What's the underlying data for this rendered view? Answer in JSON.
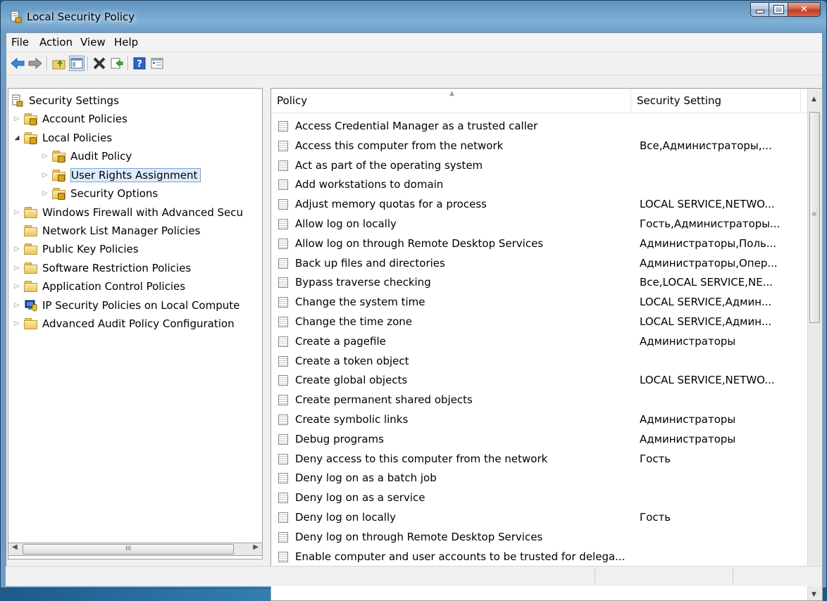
{
  "window": {
    "title": "Local Security Policy"
  },
  "menu": [
    "File",
    "Action",
    "View",
    "Help"
  ],
  "toolbar": [
    "back-icon",
    "forward-icon",
    "up-folder-icon",
    "show-hide-tree-icon",
    "delete-icon",
    "export-list-icon",
    "help-icon",
    "properties-icon"
  ],
  "tree": {
    "root": "Security Settings",
    "items": [
      "Account Policies",
      "Local Policies",
      "Audit Policy",
      "User Rights Assignment",
      "Security Options",
      "Windows Firewall with Advanced Secu",
      "Network List Manager Policies",
      "Public Key Policies",
      "Software Restriction Policies",
      "Application Control Policies",
      "IP Security Policies on Local Compute",
      "Advanced Audit Policy Configuration"
    ],
    "selected": "User Rights Assignment"
  },
  "list": {
    "columns": [
      "Policy",
      "Security Setting"
    ],
    "rows": [
      [
        "Access Credential Manager as a trusted caller",
        ""
      ],
      [
        "Access this computer from the network",
        "Все,Администраторы,..."
      ],
      [
        "Act as part of the operating system",
        ""
      ],
      [
        "Add workstations to domain",
        ""
      ],
      [
        "Adjust memory quotas for a process",
        "LOCAL SERVICE,NETWO..."
      ],
      [
        "Allow log on locally",
        "Гость,Администраторы..."
      ],
      [
        "Allow log on through Remote Desktop Services",
        "Администраторы,Поль..."
      ],
      [
        "Back up files and directories",
        "Администраторы,Опер..."
      ],
      [
        "Bypass traverse checking",
        "Все,LOCAL SERVICE,NE..."
      ],
      [
        "Change the system time",
        "LOCAL SERVICE,Админ..."
      ],
      [
        "Change the time zone",
        "LOCAL SERVICE,Админ..."
      ],
      [
        "Create a pagefile",
        "Администраторы"
      ],
      [
        "Create a token object",
        ""
      ],
      [
        "Create global objects",
        "LOCAL SERVICE,NETWO..."
      ],
      [
        "Create permanent shared objects",
        ""
      ],
      [
        "Create symbolic links",
        "Администраторы"
      ],
      [
        "Debug programs",
        "Администраторы"
      ],
      [
        "Deny access to this computer from the network",
        "Гость"
      ],
      [
        "Deny log on as a batch job",
        ""
      ],
      [
        "Deny log on as a service",
        ""
      ],
      [
        "Deny log on locally",
        "Гость"
      ],
      [
        "Deny log on through Remote Desktop Services",
        ""
      ],
      [
        "Enable computer and user accounts to be trusted for delega...",
        ""
      ]
    ]
  },
  "scrollbar": {
    "h_grip": "III"
  }
}
